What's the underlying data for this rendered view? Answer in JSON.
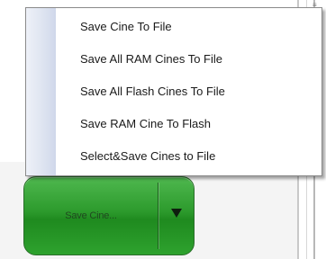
{
  "menu": {
    "items": [
      {
        "label": "Save Cine To File"
      },
      {
        "label": "Save All RAM Cines To File"
      },
      {
        "label": "Save All Flash Cines To File"
      },
      {
        "label": "Save RAM Cine To Flash"
      },
      {
        "label": "Select&Save Cines to File"
      }
    ]
  },
  "split_button": {
    "label": "Save Cine...",
    "arrow_icon": "triangle-down-icon",
    "color": "#2c9a2c"
  }
}
